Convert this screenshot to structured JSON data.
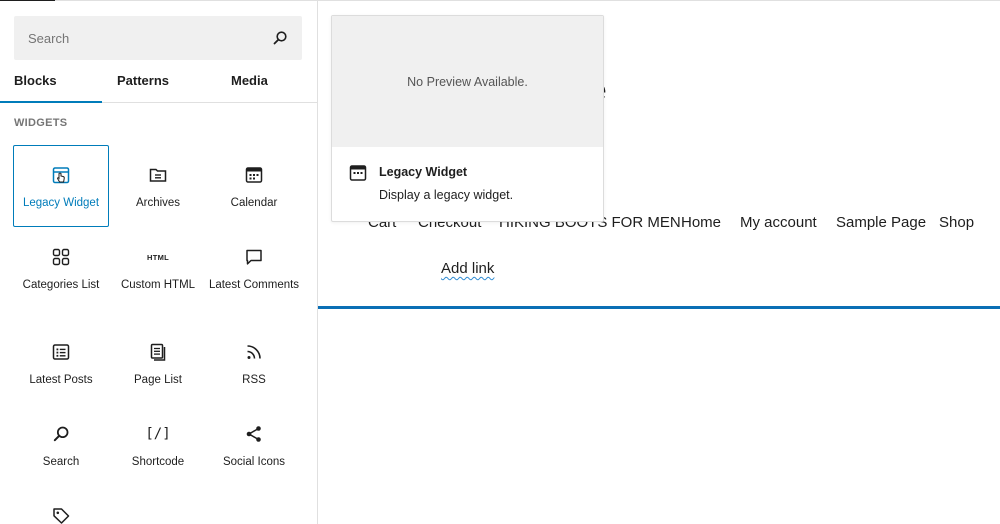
{
  "search": {
    "placeholder": "Search"
  },
  "tabs": [
    {
      "label": "Blocks",
      "active": true
    },
    {
      "label": "Patterns",
      "active": false
    },
    {
      "label": "Media",
      "active": false
    }
  ],
  "section_title": "WIDGETS",
  "blocks": [
    {
      "label": "Legacy Widget",
      "icon": "calendar-icon",
      "selected": true
    },
    {
      "label": "Archives",
      "icon": "archive-icon"
    },
    {
      "label": "Calendar",
      "icon": "calendar-icon"
    },
    {
      "label": "Categories List",
      "icon": "categories-icon"
    },
    {
      "label": "Custom HTML",
      "icon": "html-icon",
      "glyph": "HTML"
    },
    {
      "label": "Latest Comments",
      "icon": "comment-icon"
    },
    {
      "label": "Latest Posts",
      "icon": "post-list-icon"
    },
    {
      "label": "Page List",
      "icon": "pages-icon"
    },
    {
      "label": "RSS",
      "icon": "rss-icon"
    },
    {
      "label": "Search",
      "icon": "search-icon"
    },
    {
      "label": "Shortcode",
      "icon": "shortcode-icon",
      "glyph": "[/]"
    },
    {
      "label": "Social Icons",
      "icon": "share-icon"
    },
    {
      "label": "",
      "icon": "tag-icon"
    }
  ],
  "preview": {
    "placeholder": "No Preview Available.",
    "title": "Legacy Widget",
    "description": "Display a legacy widget."
  },
  "canvas": {
    "site_title_fragment": "e",
    "nav_items": [
      "Cart",
      "Checkout",
      "HIKING BOOTS FOR MEN",
      "Home",
      "My account",
      "Sample Page",
      "Shop"
    ],
    "add_link": "Add link"
  },
  "colors": {
    "accent": "#007cba",
    "rule": "#0a6fb5",
    "panel_bg": "#f0f0f0"
  }
}
